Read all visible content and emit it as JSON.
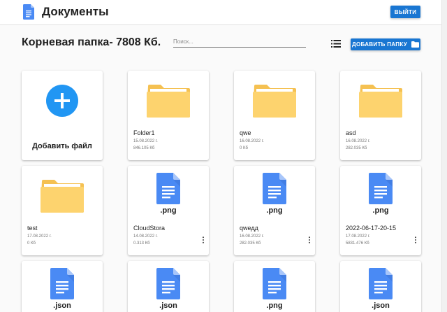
{
  "header": {
    "title": "Документы",
    "logout_label": "ВЫЙТИ",
    "logo_icon": "google-docs-icon"
  },
  "toolbar": {
    "title": "Корневая папка- 7808 Кб.",
    "search_placeholder": "Поиск...",
    "search_value": "",
    "view_icon": "list-view-icon",
    "add_folder_label": "ДОБАВИТЬ ПАПКУ",
    "add_folder_icon": "folder-icon"
  },
  "colors": {
    "accent": "#1976d2",
    "add_circle": "#2196f3",
    "folder": "#fdd36e",
    "folder_dark": "#f5c152",
    "doc": "#4a8af4",
    "doc_light": "#a8c6fa"
  },
  "add_file": {
    "label": "Добавить файл",
    "icon": "plus-icon"
  },
  "items": [
    {
      "type": "folder",
      "name": "Folder1",
      "date": "15.08.2022 г.",
      "size": "846.105 Кб"
    },
    {
      "type": "folder",
      "name": "qwe",
      "date": "16.08.2022 г.",
      "size": "0 Кб"
    },
    {
      "type": "folder",
      "name": "asd",
      "date": "16.08.2022 г.",
      "size": "282.035 Кб"
    },
    {
      "type": "folder",
      "name": "test",
      "date": "17.08.2022 г.",
      "size": "0 Кб"
    },
    {
      "type": "file",
      "ext": ".png",
      "name": "CloudStora",
      "date": "14.08.2022 г.",
      "size": "0.313 Кб"
    },
    {
      "type": "file",
      "ext": ".png",
      "name": "qwедд",
      "date": "16.08.2022 г.",
      "size": "282.035 Кб"
    },
    {
      "type": "file",
      "ext": ".png",
      "name": "2022-06-17-20-15",
      "date": "17.08.2022 г.",
      "size": "5831.476 Кб"
    },
    {
      "type": "file",
      "ext": ".json"
    },
    {
      "type": "file",
      "ext": ".json"
    },
    {
      "type": "file",
      "ext": ".png"
    },
    {
      "type": "file",
      "ext": ".json"
    }
  ]
}
